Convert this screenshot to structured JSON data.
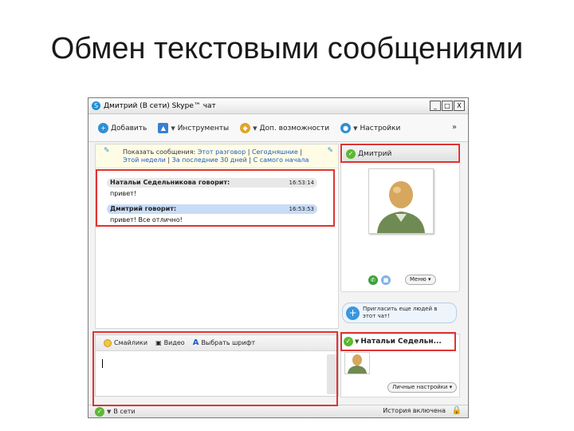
{
  "slide": {
    "title": "Обмен текстовыми сообщениями"
  },
  "window": {
    "title": "Дмитрий (В сети) Skype™ чат",
    "controls": [
      "_",
      "□",
      "X"
    ]
  },
  "toolbar": {
    "add": "Добавить",
    "tools": "Инструменты",
    "features": "Доп. возможности",
    "settings": "Настройки",
    "more": "»"
  },
  "filter": {
    "prefix": "Показать сообщения:",
    "this_chat": "Этот разговор",
    "today": "Сегодняшние",
    "week": "Этой недели",
    "last30": "За последние 30 дней",
    "since_start": "С самого начала",
    "sep": "|"
  },
  "messages": [
    {
      "author": "Натальи Седельникова говорит:",
      "time": "16:53:14",
      "text": "привет!"
    },
    {
      "author": "Дмитрий говорит:",
      "time": "16:53:53",
      "text": "привет! Все отлично!"
    }
  ],
  "side": {
    "contact_name": "Дмитрий",
    "menu": "Меню"
  },
  "invite": {
    "line1": "Пригласить еще людей в",
    "line2": "этот чат!"
  },
  "group": {
    "name": "Натальи Седельн...",
    "personal_settings": "Личные настройки"
  },
  "input_tools": {
    "smileys": "Смайлики",
    "video": "Видео",
    "font": "Выбрать шрифт"
  },
  "status": {
    "online": "В сети",
    "history": "История включена"
  },
  "colors": {
    "highlight": "#e03333",
    "self_message": "#c8dcf6",
    "other_message": "#e8e8e8",
    "online": "#5cb832",
    "skype_blue": "#1e8fd8"
  }
}
